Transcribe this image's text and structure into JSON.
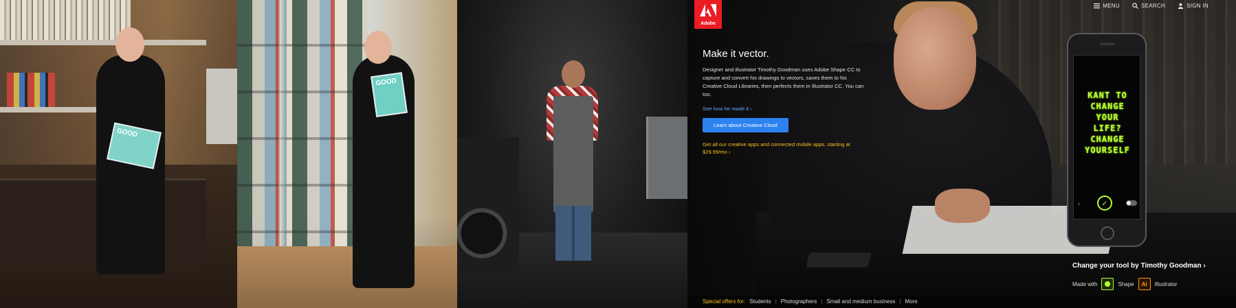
{
  "nav": {
    "menu": "MENU",
    "search": "SEARCH",
    "signin": "SIGN IN"
  },
  "logo": {
    "wordmark": "Adobe"
  },
  "hero": {
    "title": "Make it vector.",
    "description": "Designer and illustrator Timothy Goodman uses Adobe Shape CC to capture and convert his drawings to vectors, saves them to his Creative Cloud Libraries, then perfects them in Illustrator CC. You can too.",
    "see_how": "See how he made it ›",
    "cta": "Learn about Creative Cloud",
    "offer": "Get all our creative apps and connected mobile apps, starting at $29.99/mo ›"
  },
  "phone": {
    "lettering": [
      "KANT TO",
      "CHANGE",
      "YOUR LIFE?",
      "CHANGE",
      "YOURSELF"
    ]
  },
  "credit": {
    "title": "Change your tool by Timothy Goodman ›",
    "made_with": "Made with",
    "app1": "Shape",
    "app2": "Illustrator",
    "app2_icon": "Ai"
  },
  "special_offers": {
    "label": "Special offers for:",
    "links": [
      "Students",
      "Photographers",
      "Small and medium business",
      "More"
    ]
  },
  "photos": {
    "p1_magazine": "GOOD",
    "p2_magazine": "GOOD"
  },
  "colors": {
    "adobe_red": "#ec1c24",
    "link_blue": "#5fa8ff",
    "cta_blue": "#2d82f0",
    "offer_yellow": "#f4c21d",
    "shape_green": "#b7ff2e"
  }
}
